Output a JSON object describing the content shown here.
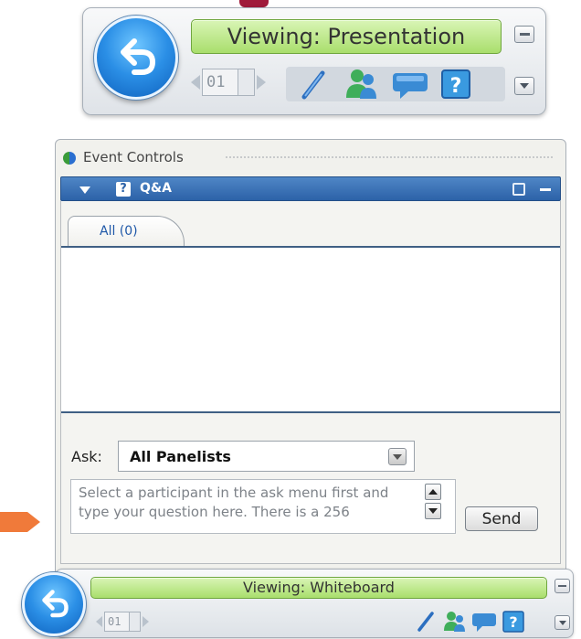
{
  "top_toolbar": {
    "viewing_label": "Viewing: Presentation",
    "page_number": "01"
  },
  "event_panel": {
    "title": "Event Controls",
    "qa_title": "Q&A",
    "tab_all": "All (0)",
    "ask_label": "Ask:",
    "ask_selected": "All Panelists",
    "question_text": "Select a participant in the ask menu first and type your question here. There is a 256",
    "send_label": "Send"
  },
  "bottom_toolbar": {
    "viewing_label": "Viewing: Whiteboard",
    "page_number": "01"
  },
  "icons": {
    "back": "back-arrow-icon",
    "pen": "pen-icon",
    "attendees": "attendees-icon",
    "chat": "chat-icon",
    "qa": "question-icon"
  },
  "colors": {
    "accent_blue": "#2c62a8",
    "viewing_green": "#a9de6c",
    "arrow_orange": "#f07a3a"
  }
}
